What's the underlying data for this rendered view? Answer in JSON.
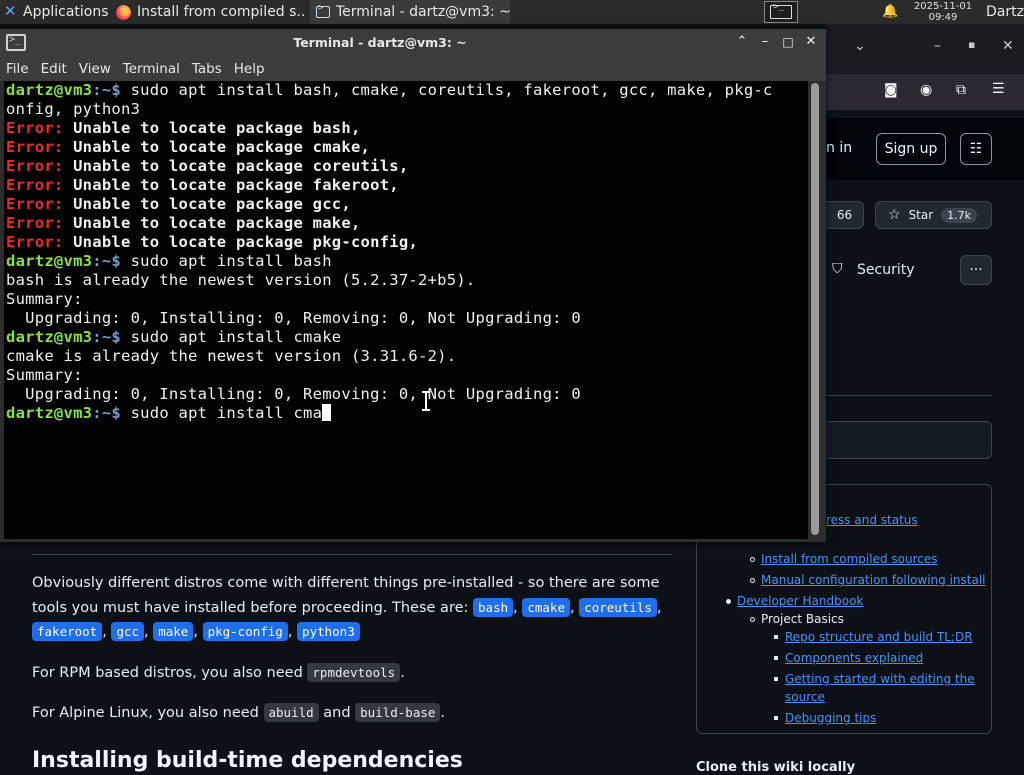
{
  "panel": {
    "applications_label": "Applications",
    "tasks": [
      {
        "label": "Install from compiled s...",
        "icon": "firefox-icon"
      },
      {
        "label": "Terminal - dartz@vm3: ~",
        "icon": "terminal-icon"
      }
    ],
    "date": "2025-11-01",
    "time": "09:49",
    "user": "Dartz"
  },
  "browser": {
    "sign_in_fragment": "n in",
    "sign_up_label": "Sign up",
    "watch_count": "66",
    "star_label": "Star",
    "star_count": "1.7k",
    "security_label": "Security",
    "more_label": "···"
  },
  "terminal": {
    "title": "Terminal - dartz@vm3: ~",
    "menu": [
      "File",
      "Edit",
      "View",
      "Terminal",
      "Tabs",
      "Help"
    ],
    "prompt_user": "dartz@vm3",
    "prompt_path": ":~$",
    "lines": [
      {
        "type": "cmd",
        "text": " sudo apt install bash, cmake, coreutils, fakeroot, gcc, make, pkg-c"
      },
      {
        "type": "out",
        "text": "onfig, python3"
      },
      {
        "type": "err",
        "label": "Error:",
        "text": " Unable to locate package bash,"
      },
      {
        "type": "err",
        "label": "Error:",
        "text": " Unable to locate package cmake,"
      },
      {
        "type": "err",
        "label": "Error:",
        "text": " Unable to locate package coreutils,"
      },
      {
        "type": "err",
        "label": "Error:",
        "text": " Unable to locate package fakeroot,"
      },
      {
        "type": "err",
        "label": "Error:",
        "text": " Unable to locate package gcc,"
      },
      {
        "type": "err",
        "label": "Error:",
        "text": " Unable to locate package make,"
      },
      {
        "type": "err",
        "label": "Error:",
        "text": " Unable to locate package pkg-config,"
      },
      {
        "type": "cmd",
        "text": " sudo apt install bash"
      },
      {
        "type": "out",
        "text": "bash is already the newest version (5.2.37-2+b5)."
      },
      {
        "type": "out",
        "text": "Summary:"
      },
      {
        "type": "out",
        "text": "  Upgrading: 0, Installing: 0, Removing: 0, Not Upgrading: 0"
      },
      {
        "type": "cmd",
        "text": " sudo apt install cmake"
      },
      {
        "type": "out",
        "text": "cmake is already the newest version (3.31.6-2)."
      },
      {
        "type": "out",
        "text": "Summary:"
      },
      {
        "type": "out",
        "text": "  Upgrading: 0, Installing: 0, Removing: 0, Not Upgrading: 0"
      },
      {
        "type": "cmd",
        "text": " sudo apt install cma",
        "cursor": true
      }
    ]
  },
  "wiki": {
    "para1_line1": "Obviously different distros come with different things pre-installed - so there are some",
    "para1_line2": "tools you must have installed before proceeding. These are: ",
    "packages": [
      "bash",
      "cmake",
      "coreutils",
      "fakeroot",
      "gcc",
      "make",
      "pkg-config",
      "python3"
    ],
    "sep": ",",
    "rpm_text": "For RPM based distros, you also need ",
    "rpm_code": "rpmdevtools",
    "period": ".",
    "alpine_text": "For Alpine Linux, you also need ",
    "alpine_code1": "abuild",
    "and_text": " and ",
    "alpine_code2": "build-base",
    "heading": "Installing build-time dependencies"
  },
  "toc": {
    "frag_progress": "ress and status",
    "items": [
      {
        "label": "Install from compiled sources",
        "link": true
      },
      {
        "label": "Manual configuration following install",
        "link": true
      },
      {
        "label": "Developer Handbook",
        "link": true
      },
      {
        "label": "Project Basics",
        "link": false
      },
      {
        "label": "Repo structure and build TL;DR",
        "link": true
      },
      {
        "label": "Components explained",
        "link": true
      },
      {
        "label": "Getting started with editing the",
        "link": true
      },
      {
        "label": "source",
        "link": true
      },
      {
        "label": "Debugging tips",
        "link": true
      }
    ],
    "clone_heading": "Clone this wiki locally"
  }
}
